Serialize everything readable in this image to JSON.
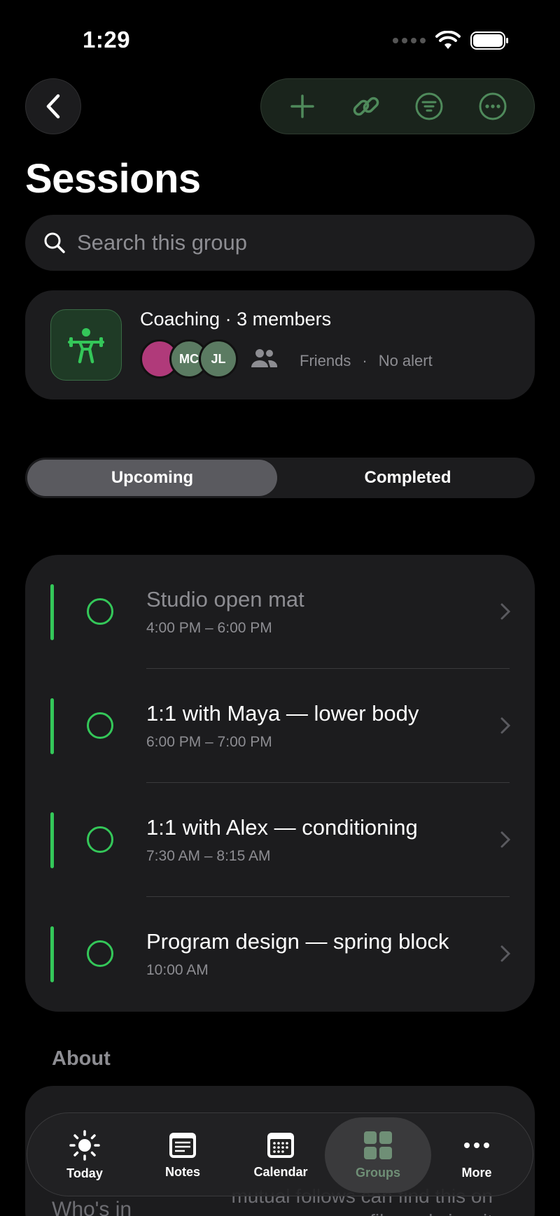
{
  "status": {
    "time": "1:29"
  },
  "header": {
    "title": "Sessions"
  },
  "search": {
    "placeholder": "Search this group"
  },
  "group": {
    "title": "Coaching · 3 members",
    "avatars": [
      "",
      "MC",
      "JL"
    ],
    "audience": "Friends",
    "separator": "·",
    "alert": "No alert"
  },
  "segments": {
    "upcoming": "Upcoming",
    "completed": "Completed",
    "selected": "Upcoming"
  },
  "sessions": [
    {
      "title": "Studio open mat",
      "time": "4:00 PM – 6:00 PM"
    },
    {
      "title": "1:1 with Maya — lower body",
      "time": "6:00 PM – 7:00 PM"
    },
    {
      "title": "1:1 with Alex — conditioning",
      "time": "7:30 AM – 8:15 AM"
    },
    {
      "title": "Program design — spring block",
      "time": "10:00 AM"
    }
  ],
  "about": {
    "heading": "About",
    "left_text": "Who's in",
    "right_text_1": "mutual follows can find this on",
    "right_text_2": "your profile and view it"
  },
  "tabbar": {
    "items": [
      {
        "label": "Today",
        "icon": "sun-icon"
      },
      {
        "label": "Notes",
        "icon": "notes-icon"
      },
      {
        "label": "Calendar",
        "icon": "calendar-icon"
      },
      {
        "label": "Groups",
        "icon": "grid-icon"
      },
      {
        "label": "More",
        "icon": "more-dots-icon"
      }
    ],
    "active": "Groups"
  },
  "colors": {
    "accent": "#34c759",
    "background": "#000000",
    "card": "#1c1c1e",
    "muted": "#8d8d92"
  }
}
